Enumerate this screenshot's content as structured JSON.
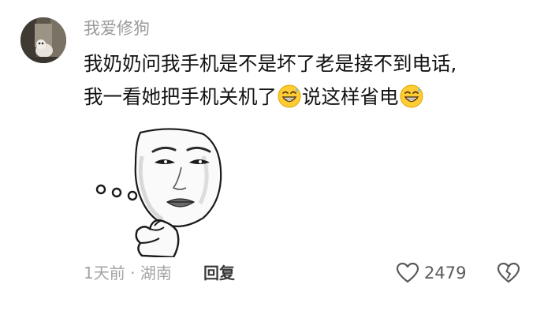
{
  "comment": {
    "username": "我爱修狗",
    "text_line1": "我奶奶问我手机是不是坏了老是接不到电话,",
    "text_line2_a": "我一看她把手机关机了",
    "text_line2_b": "说这样省电",
    "emoji_name": "grinning-sweat-emoji",
    "meme_name": "thinking-meme-sticker",
    "time_location": "1天前 · 湖南",
    "reply_label": "回复",
    "like_count": "2479"
  },
  "colors": {
    "username": "#9a9a9a",
    "meta": "#a3a3a3",
    "text": "#121212"
  }
}
